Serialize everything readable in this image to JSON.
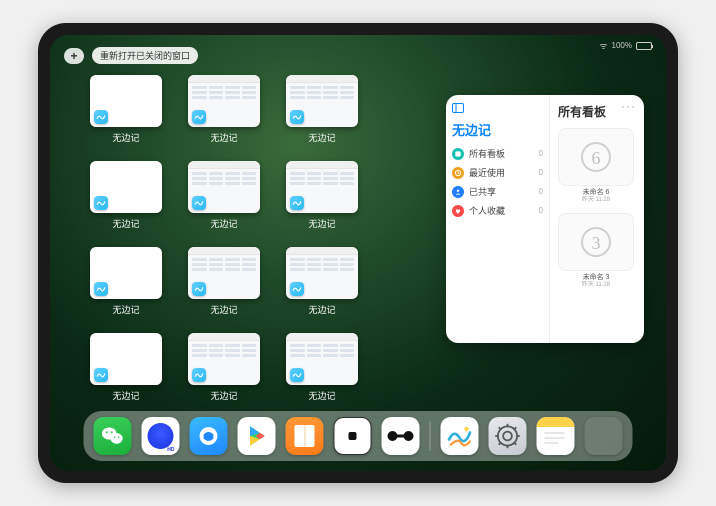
{
  "status": {
    "battery_pct": "100%"
  },
  "top": {
    "plus": "+",
    "reopen_label": "重新打开已关闭的窗口"
  },
  "app_name": "无边记",
  "apps_grid": [
    {
      "label": "无边记",
      "variant": "blank"
    },
    {
      "label": "无边记",
      "variant": "doc"
    },
    {
      "label": "无边记",
      "variant": "doc"
    },
    {
      "label": "",
      "variant": "hidden"
    },
    {
      "label": "无边记",
      "variant": "blank"
    },
    {
      "label": "无边记",
      "variant": "doc"
    },
    {
      "label": "无边记",
      "variant": "doc"
    },
    {
      "label": "",
      "variant": "hidden"
    },
    {
      "label": "无边记",
      "variant": "blank"
    },
    {
      "label": "无边记",
      "variant": "doc"
    },
    {
      "label": "无边记",
      "variant": "doc"
    },
    {
      "label": "",
      "variant": "hidden"
    },
    {
      "label": "无边记",
      "variant": "blank"
    },
    {
      "label": "无边记",
      "variant": "doc"
    },
    {
      "label": "无边记",
      "variant": "doc"
    }
  ],
  "panel": {
    "left_title": "无边记",
    "right_title": "所有看板",
    "menu": [
      {
        "label": "所有看板",
        "count": "0",
        "icon": "boards",
        "color": "#15c0b0"
      },
      {
        "label": "最近使用",
        "count": "0",
        "icon": "recent",
        "color": "#f0a020"
      },
      {
        "label": "已共享",
        "count": "0",
        "icon": "shared",
        "color": "#2080ff"
      },
      {
        "label": "个人收藏",
        "count": "0",
        "icon": "favorite",
        "color": "#ff4a4a"
      }
    ],
    "boards": [
      {
        "title": "未命名 6",
        "subtitle": "昨天 11:28",
        "sketch": "6"
      },
      {
        "title": "未命名 3",
        "subtitle": "昨天 11:28",
        "sketch": "3"
      }
    ]
  },
  "dock": {
    "items": [
      {
        "name": "wechat"
      },
      {
        "name": "quark"
      },
      {
        "name": "uc-browser"
      },
      {
        "name": "play"
      },
      {
        "name": "books"
      },
      {
        "name": "dice"
      },
      {
        "name": "dumbbell"
      },
      {
        "name": "freeform"
      },
      {
        "name": "settings"
      },
      {
        "name": "notes"
      },
      {
        "name": "app-folder"
      }
    ]
  }
}
